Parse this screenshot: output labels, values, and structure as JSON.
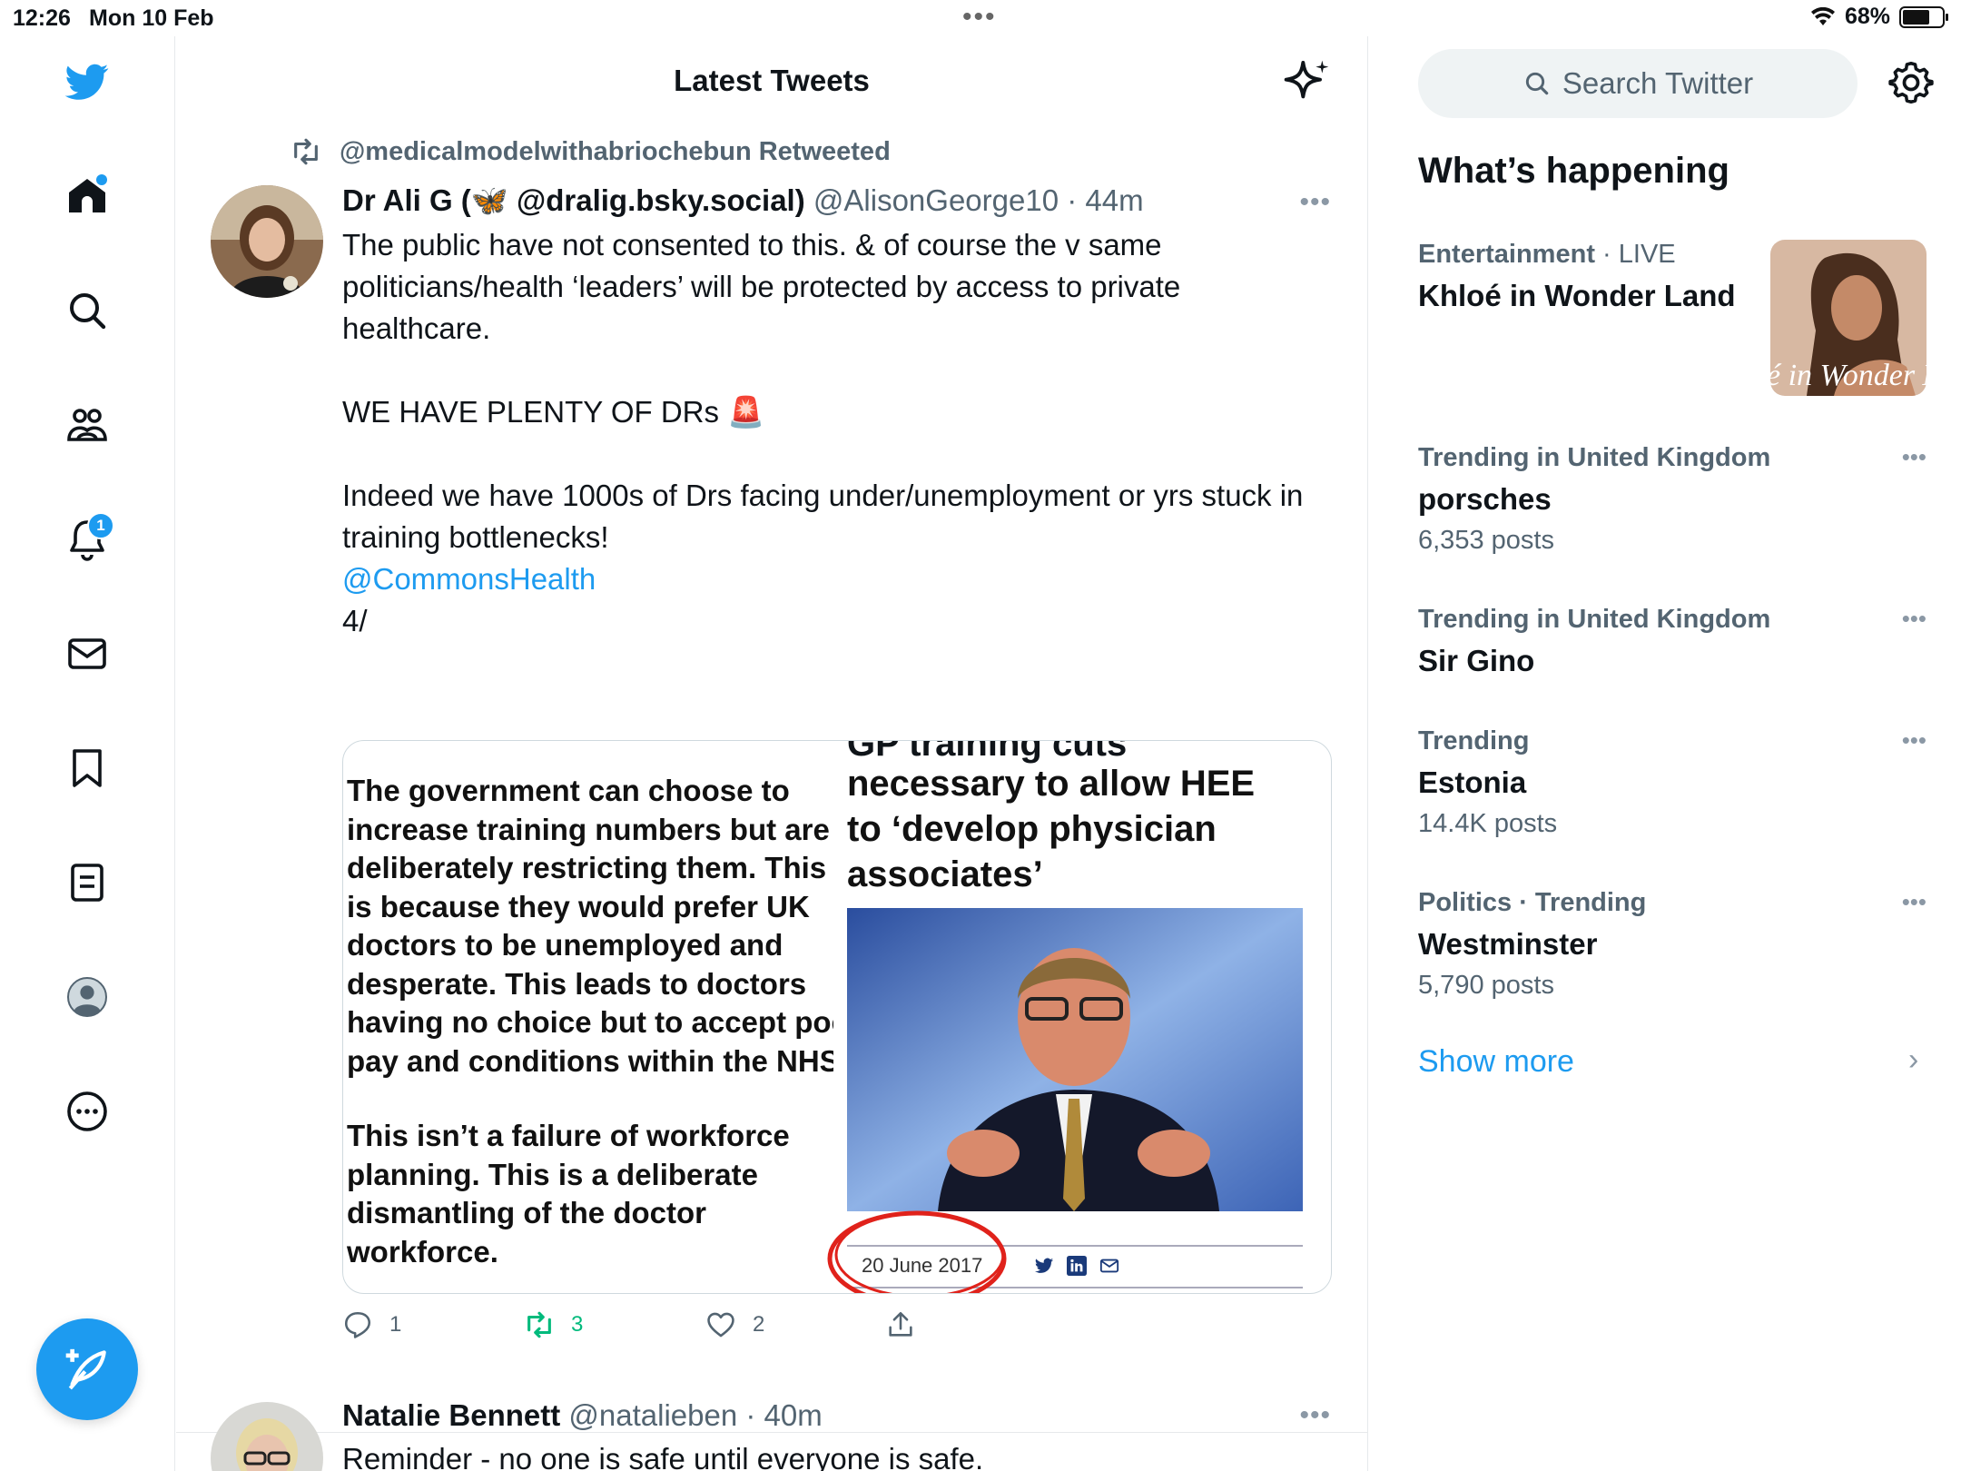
{
  "status_bar": {
    "time": "12:26",
    "date": "Mon 10 Feb",
    "battery": "68%",
    "battery_level": 0.68
  },
  "nav": {
    "icons": [
      "twitter-logo-icon",
      "home-icon",
      "search-icon",
      "communities-icon",
      "notifications-icon",
      "messages-icon",
      "bookmarks-icon",
      "lists-icon",
      "profile-icon",
      "more-icon"
    ],
    "notifications_badge": "1",
    "accent": "#1d9bf0"
  },
  "main": {
    "title": "Latest Tweets",
    "tweets": [
      {
        "retweeted_by": "@medicalmodelwithabriochebun Retweeted",
        "name": "Dr Ali G (🦋 @dralig.bsky.social)",
        "handle": "@AlisonGeorge10",
        "sep": " · ",
        "time": "44m",
        "text": "The public have not consented to this. & of course the v same politicians/health ‘leaders’ will be protected by access to private healthcare.\n\nWE HAVE PLENTY OF DRs 🚨\n\nIndeed we have 1000s of Drs facing under/unemployment or yrs stuck in training bottlenecks!\n",
        "mention": "@CommonsHealth",
        "text_end": "4/",
        "media": {
          "left_para_1": "The government can choose to\nincrease training numbers but are\ndeliberately restricting them. This\nis because they would prefer UK\ndoctors to be unemployed and\ndesperate. This leads to doctors\nhaving no choice but to accept poo\npay and conditions within the NHS",
          "left_para_2": "This isn’t a failure of workforce\nplanning. This is a deliberate\ndismantling of the doctor\nworkforce.",
          "headline_cut": "GP training cuts",
          "headline": "necessary to allow HEE\nto ‘develop physician\nassociates’",
          "article_date": "20 June 2017"
        },
        "actions": {
          "replies": "1",
          "retweets": "3",
          "likes": "2"
        }
      },
      {
        "name": "Natalie Bennett",
        "handle": "@natalieben",
        "sep": " · ",
        "time": "40m",
        "text": "Reminder - no one is safe until everyone is safe."
      }
    ]
  },
  "sidebar": {
    "search_placeholder": "Search Twitter",
    "section_title": "What’s happening",
    "trends": [
      {
        "category": "Entertainment",
        "sep": " · ",
        "extra": "LIVE",
        "name": "Khloé in Wonder Land",
        "count": "",
        "thumb_text": "é in Wonder L"
      },
      {
        "category": "Trending in United Kingdom",
        "name": "porsches",
        "count": "6,353 posts"
      },
      {
        "category": "Trending in United Kingdom",
        "name": "Sir Gino",
        "count": ""
      },
      {
        "category": "Trending",
        "name": "Estonia",
        "count": "14.4K posts"
      },
      {
        "category": "Politics · Trending",
        "name": "Westminster",
        "count": "5,790 posts"
      }
    ],
    "show_more": "Show more",
    "chevron": "›"
  }
}
